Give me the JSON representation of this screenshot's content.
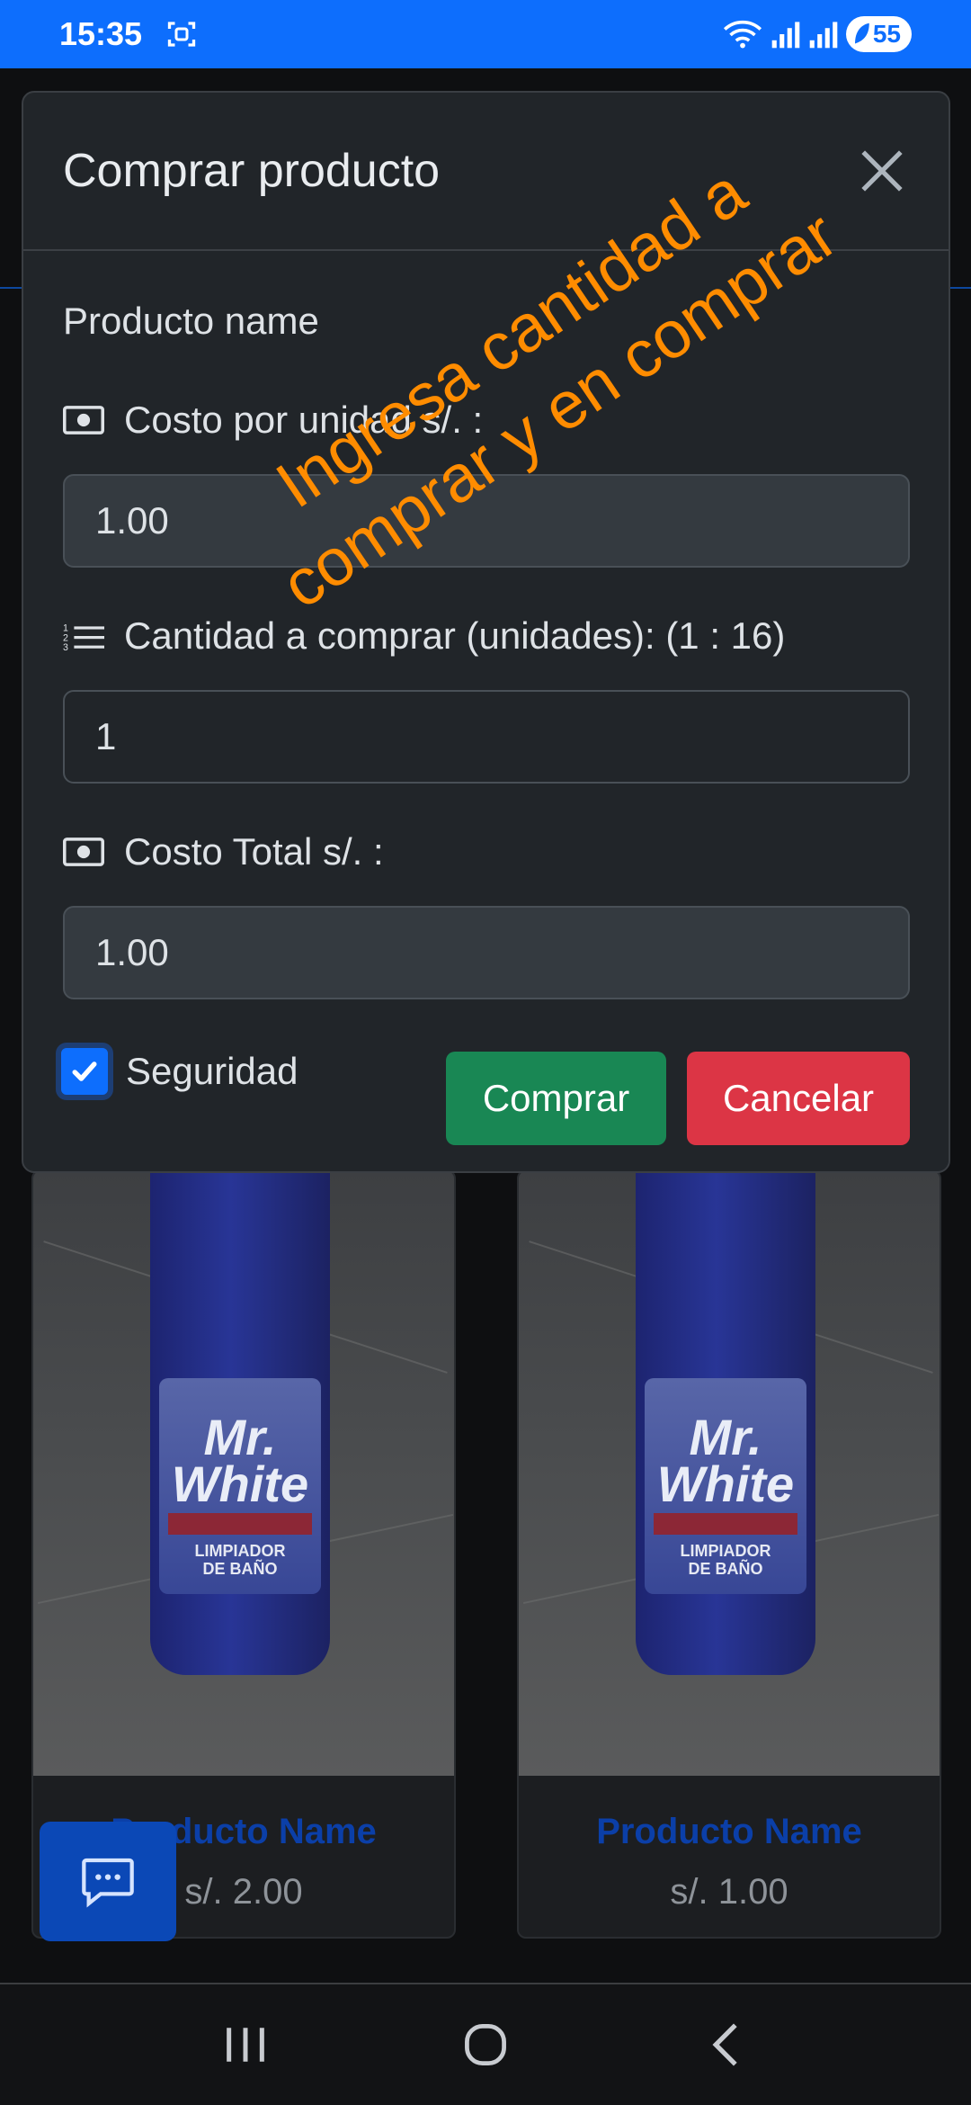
{
  "status_bar": {
    "time": "15:35",
    "battery": "55",
    "icons": [
      "screenshot-icon",
      "wifi-icon",
      "signal-icon",
      "signal-icon",
      "battery-saver-icon"
    ]
  },
  "background": {
    "cards": [
      {
        "name": "Producto Name",
        "price": "s/. 2.00",
        "image_text": {
          "brand": "Mr.\nWhite",
          "subtitle": "LIMPIADOR\nDE BAÑO"
        }
      },
      {
        "name": "Producto Name",
        "price": "s/. 1.00",
        "image_text": {
          "brand": "Mr.\nWhite",
          "subtitle": "LIMPIADOR\nDE BAÑO"
        }
      }
    ]
  },
  "modal": {
    "title": "Comprar producto",
    "product_name": "Producto name",
    "unit_cost_label": "Costo por unidad s/. :",
    "unit_cost_value": "1.00",
    "quantity_label": "Cantidad a comprar (unidades): (1 : 16)",
    "quantity_value": "1",
    "total_label": "Costo Total s/. :",
    "total_value": "1.00",
    "security_label": "Seguridad",
    "security_checked": true,
    "buy_button": "Comprar",
    "cancel_button": "Cancelar"
  },
  "annotation": "Ingresa cantidad a comprar y en comprar",
  "colors": {
    "primary": "#0d6efd",
    "success": "#198754",
    "danger": "#dc3545",
    "annotation": "#ff8c00"
  }
}
